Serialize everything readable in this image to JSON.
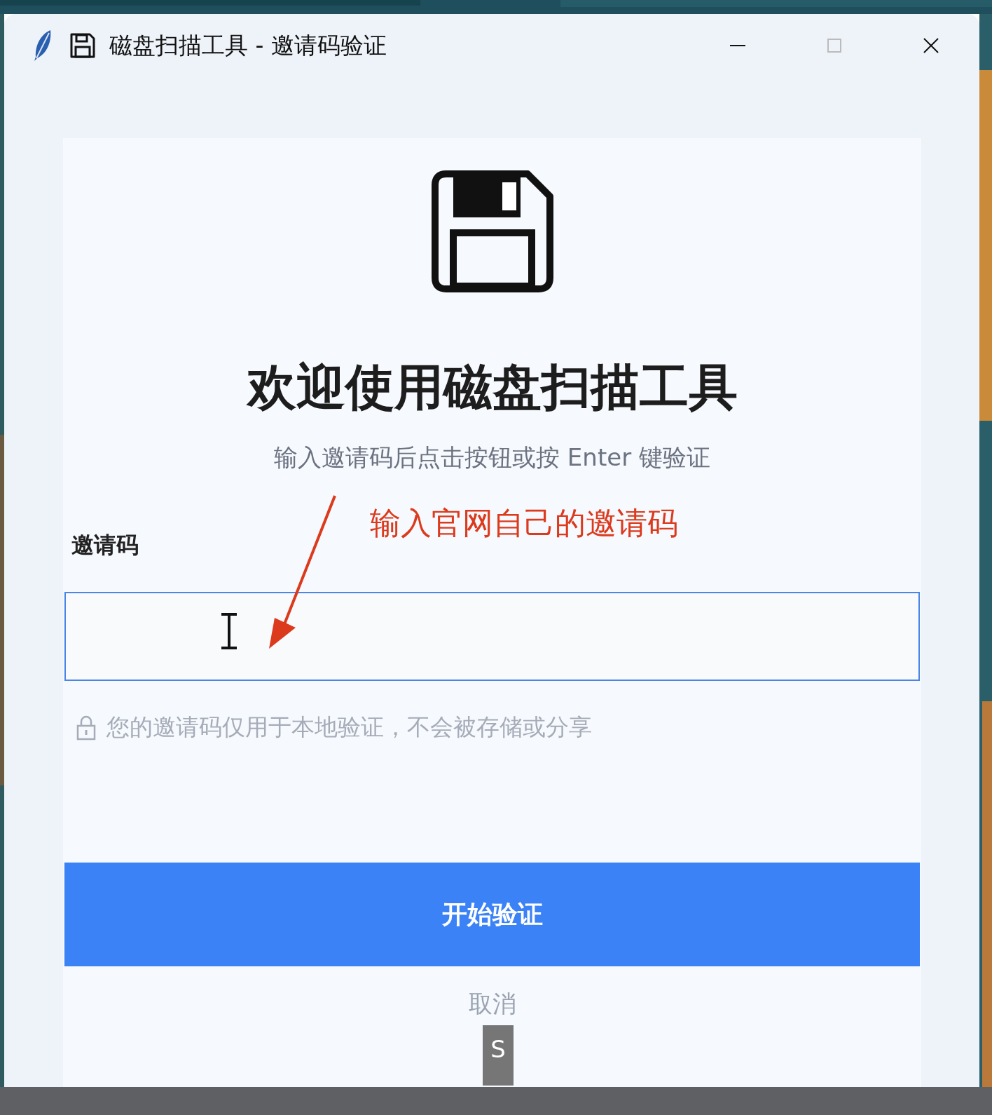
{
  "window": {
    "title": "磁盘扫描工具 - 邀请码验证"
  },
  "heading": "欢迎使用磁盘扫描工具",
  "subtitle": "输入邀请码后点击按钮或按 Enter 键验证",
  "field": {
    "label": "邀请码",
    "focused": true
  },
  "privacy_note": "您的邀请码仅用于本地验证，不会被存储或分享",
  "buttons": [
    {
      "label": "开始验证",
      "kind": "primary"
    },
    {
      "label": "取消",
      "kind": "link"
    }
  ],
  "annotation": "输入官网自己的邀请码",
  "overlay_key": "S"
}
